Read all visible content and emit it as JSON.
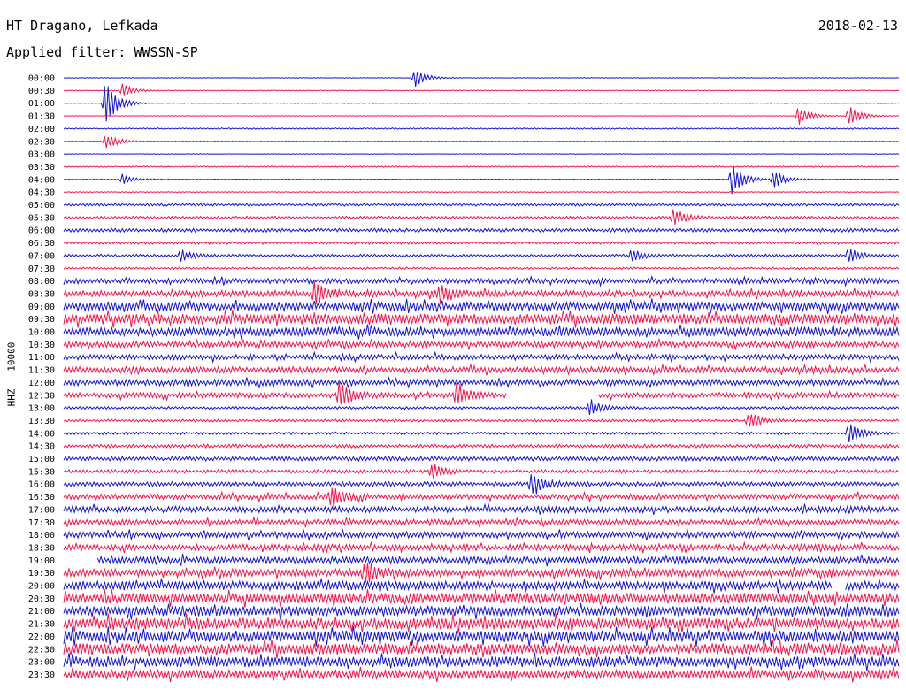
{
  "header": {
    "station": "HT Dragano, Lefkada",
    "date": "2018-02-13",
    "filter": "Applied filter: WWSSN-SP",
    "channel": "HHZ - 10000"
  },
  "colors": {
    "trace_a": "#1414d2",
    "trace_b": "#f5144b"
  },
  "chart_data": {
    "type": "line",
    "title": "HT Dragano, Lefkada",
    "subtitle": "Applied filter: WWSSN-SP",
    "ylabel": "HHZ - 10000",
    "row_interval_minutes": 30,
    "row_labels": [
      "00:00",
      "00:30",
      "01:00",
      "01:30",
      "02:00",
      "02:30",
      "03:00",
      "03:30",
      "04:00",
      "04:30",
      "05:00",
      "05:30",
      "06:00",
      "06:30",
      "07:00",
      "07:30",
      "08:00",
      "08:30",
      "09:00",
      "09:30",
      "10:00",
      "10:30",
      "11:00",
      "11:30",
      "12:00",
      "12:30",
      "13:00",
      "13:30",
      "14:00",
      "14:30",
      "15:00",
      "15:30",
      "16:00",
      "16:30",
      "17:00",
      "17:30",
      "18:00",
      "18:30",
      "19:00",
      "19:30",
      "20:00",
      "20:30",
      "21:00",
      "21:30",
      "22:00",
      "22:30",
      "23:00",
      "23:30"
    ],
    "row_colors": [
      "blue",
      "red"
    ],
    "noise_level": [
      0.3,
      0.5,
      0.3,
      0.3,
      0.8,
      0.5,
      0.3,
      0.8,
      0.4,
      0.5,
      1.5,
      1.5,
      2,
      1.5,
      1.5,
      1.2,
      3,
      3.5,
      5,
      6,
      5,
      3.5,
      3,
      3.5,
      3.5,
      3,
      1.5,
      1.5,
      1.5,
      2,
      2.5,
      2,
      2.5,
      3,
      3.5,
      3,
      3.5,
      3.5,
      4,
      4.5,
      5,
      6,
      6,
      6.5,
      6.5,
      6.5,
      6,
      5
    ],
    "events": [
      {
        "row": 0,
        "time": 0.42,
        "amp": 12
      },
      {
        "row": 1,
        "time": 0.07,
        "amp": 8
      },
      {
        "row": 2,
        "time": 0.05,
        "amp": 30
      },
      {
        "row": 3,
        "time": 0.88,
        "amp": 12
      },
      {
        "row": 3,
        "time": 0.94,
        "amp": 14
      },
      {
        "row": 5,
        "time": 0.05,
        "amp": 10
      },
      {
        "row": 8,
        "time": 0.07,
        "amp": 6
      },
      {
        "row": 8,
        "time": 0.8,
        "amp": 22
      },
      {
        "row": 8,
        "time": 0.85,
        "amp": 12
      },
      {
        "row": 11,
        "time": 0.73,
        "amp": 11
      },
      {
        "row": 14,
        "time": 0.14,
        "amp": 7
      },
      {
        "row": 14,
        "time": 0.68,
        "amp": 8
      },
      {
        "row": 14,
        "time": 0.94,
        "amp": 9
      },
      {
        "row": 17,
        "time": 0.3,
        "amp": 14
      },
      {
        "row": 17,
        "time": 0.45,
        "amp": 12
      },
      {
        "row": 25,
        "time": 0.33,
        "amp": 16
      },
      {
        "row": 25,
        "time": 0.47,
        "amp": 14
      },
      {
        "row": 26,
        "time": 0.63,
        "amp": 10
      },
      {
        "row": 27,
        "time": 0.82,
        "amp": 11
      },
      {
        "row": 28,
        "time": 0.94,
        "amp": 15
      },
      {
        "row": 31,
        "time": 0.44,
        "amp": 10
      },
      {
        "row": 32,
        "time": 0.56,
        "amp": 16
      },
      {
        "row": 33,
        "time": 0.32,
        "amp": 14
      },
      {
        "row": 39,
        "time": 0.36,
        "amp": 14
      }
    ],
    "gaps": [
      {
        "row": 25,
        "start": 0.53,
        "end": 0.64
      },
      {
        "row": 38,
        "start": 0.0,
        "end": 0.04
      },
      {
        "row": 40,
        "start": 0.92,
        "end": 0.935
      }
    ]
  }
}
